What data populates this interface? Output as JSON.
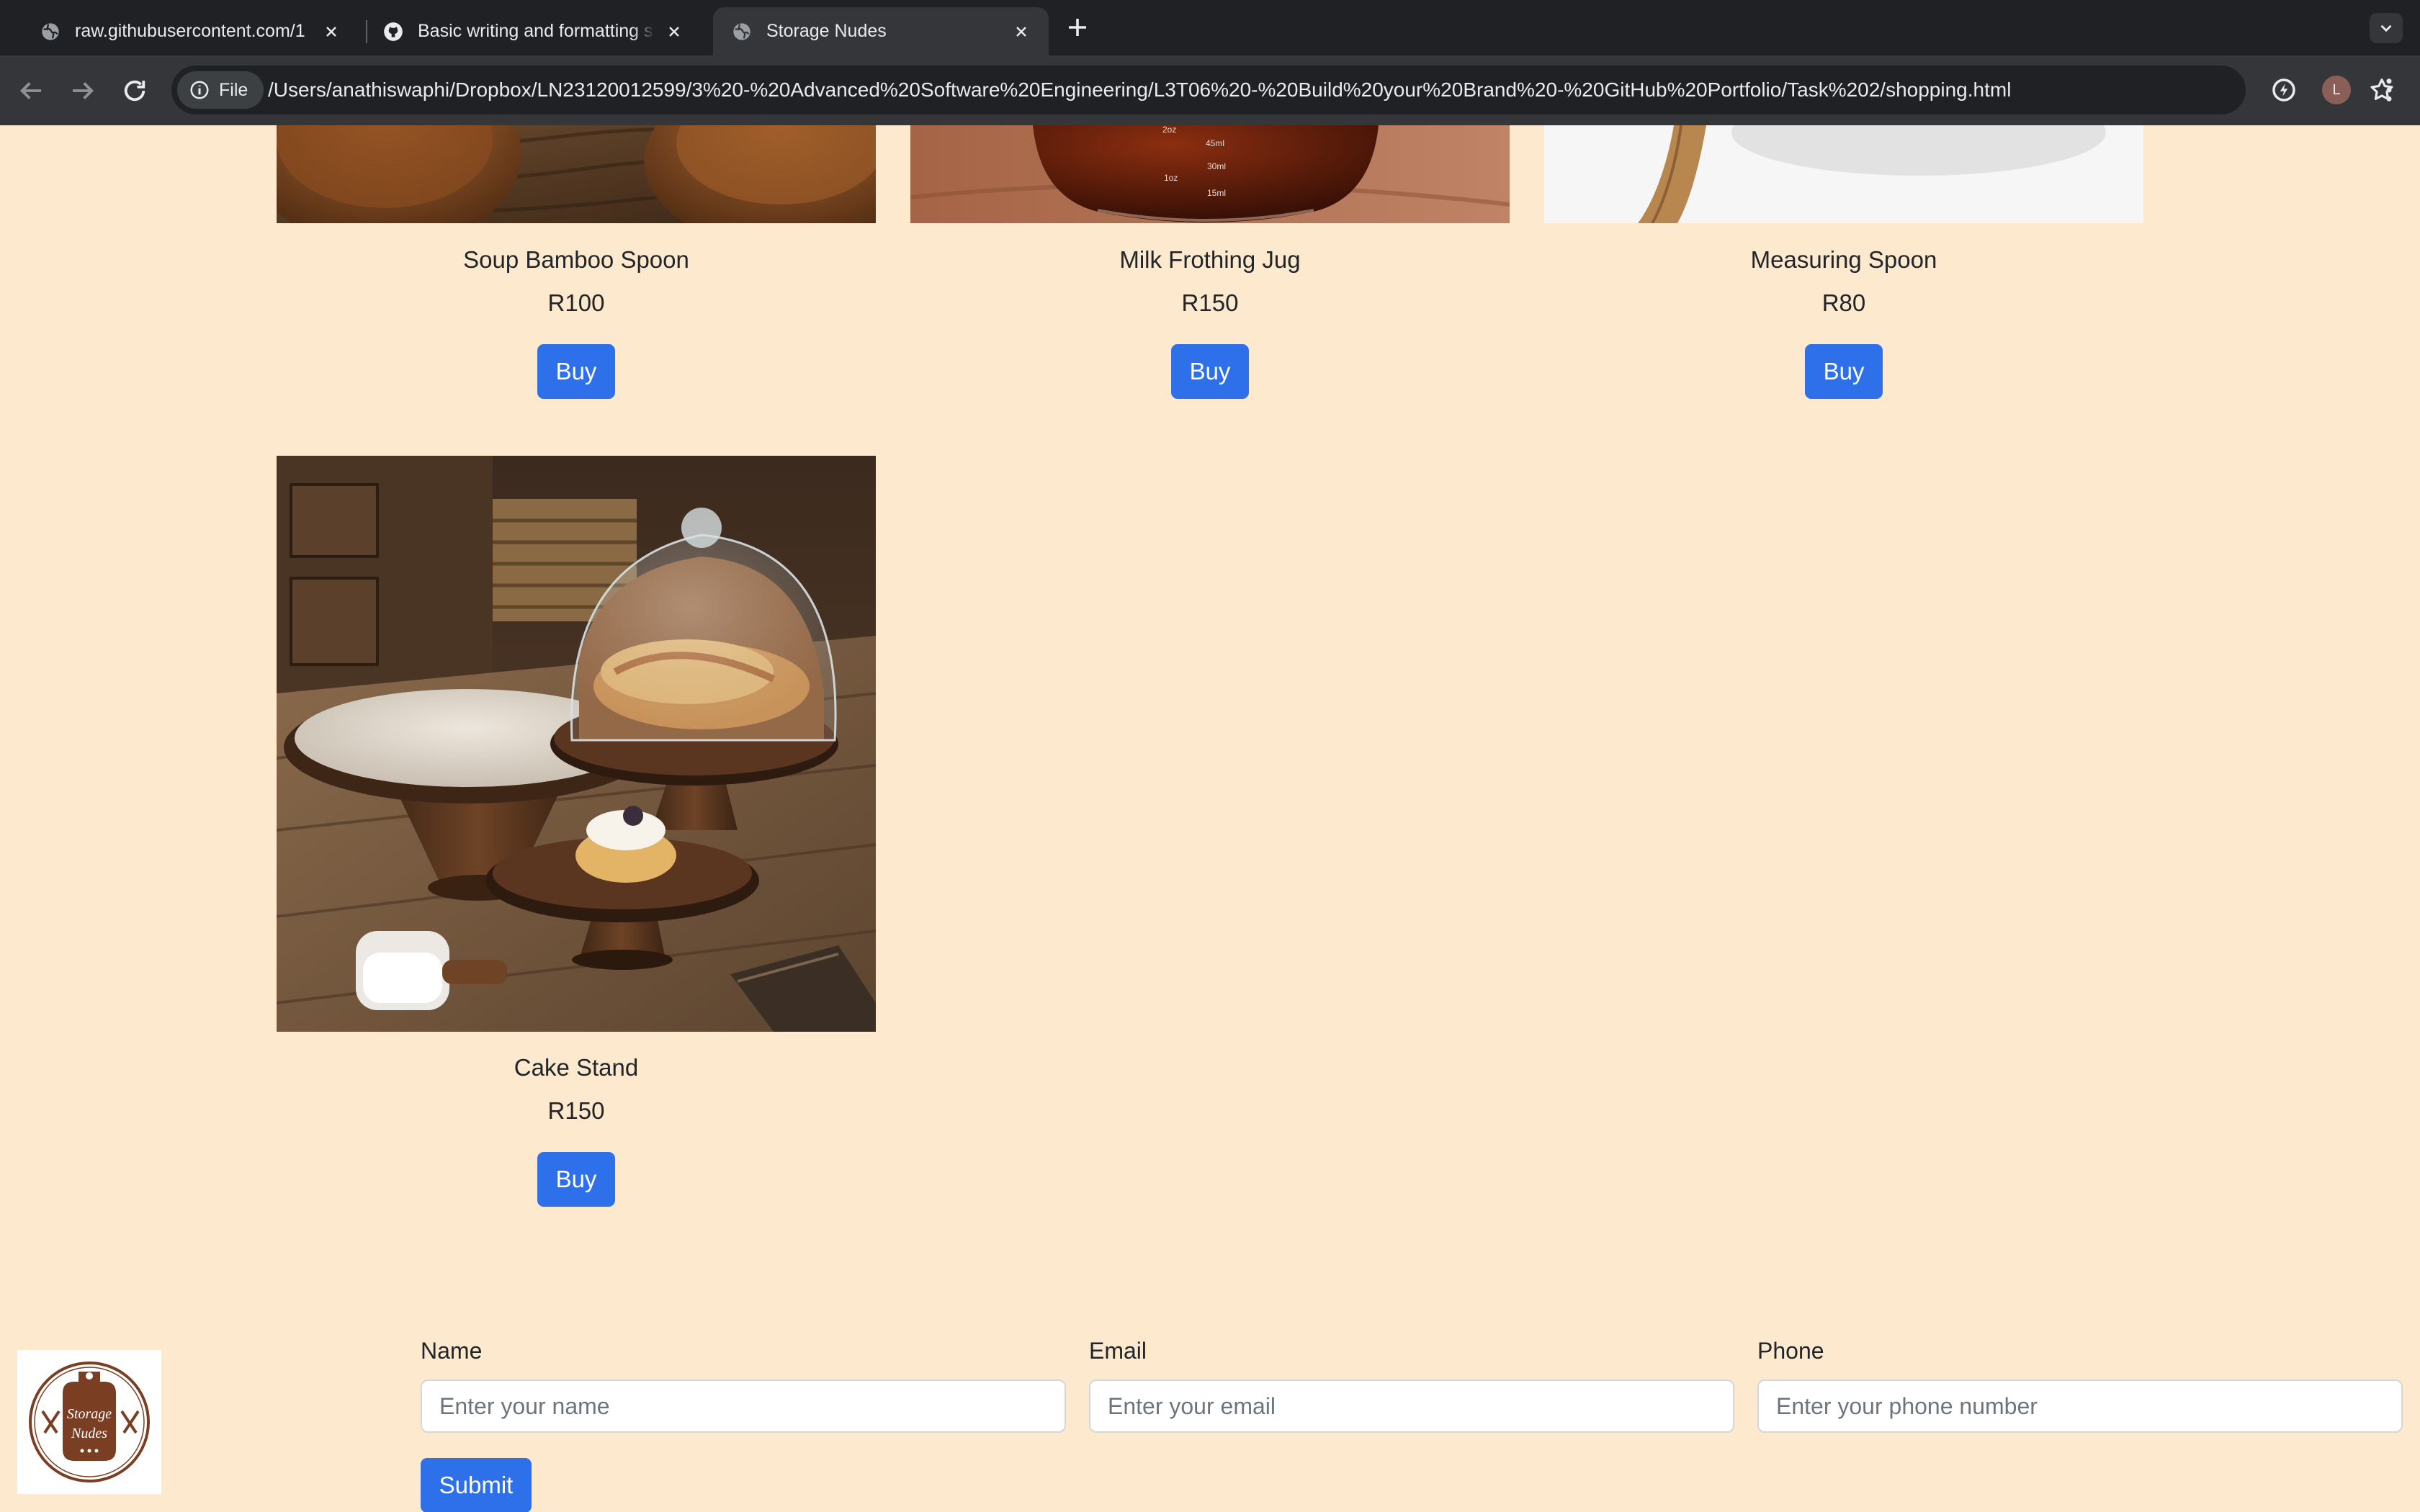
{
  "browser": {
    "tabs": [
      {
        "title": "raw.githubusercontent.com/1"
      },
      {
        "title": "Basic writing and formatting s"
      },
      {
        "title": "Storage Nudes"
      }
    ],
    "address": {
      "chip_label": "File",
      "url": "/Users/anathiswaphi/Dropbox/LN23120012599/3%20-%20Advanced%20Software%20Engineering/L3T06%20-%20Build%20your%20Brand%20-%20GitHub%20Portfolio/Task%202/shopping.html"
    },
    "profile_initial": "L"
  },
  "products": [
    {
      "name": "Soup Bamboo Spoon",
      "price": "R100",
      "button": "Buy"
    },
    {
      "name": "Milk Frothing Jug",
      "price": "R150",
      "button": "Buy"
    },
    {
      "name": "Measuring Spoon",
      "price": "R80",
      "button": "Buy"
    },
    {
      "name": "Cake Stand",
      "price": "R150",
      "button": "Buy"
    }
  ],
  "jug_markings": [
    "2oz",
    "45ml",
    "30ml",
    "1oz",
    "15ml"
  ],
  "form": {
    "name_label": "Name",
    "name_placeholder": "Enter your name",
    "email_label": "Email",
    "email_placeholder": "Enter your email",
    "phone_label": "Phone",
    "phone_placeholder": "Enter your phone number",
    "submit_label": "Submit"
  },
  "logo": {
    "line1": "Storage",
    "line2": "Nudes"
  },
  "colors": {
    "page_background": "#FCE9CE",
    "button_blue": "#2E6FEA",
    "chrome_dark": "#202124",
    "chrome_toolbar": "#35363A"
  }
}
